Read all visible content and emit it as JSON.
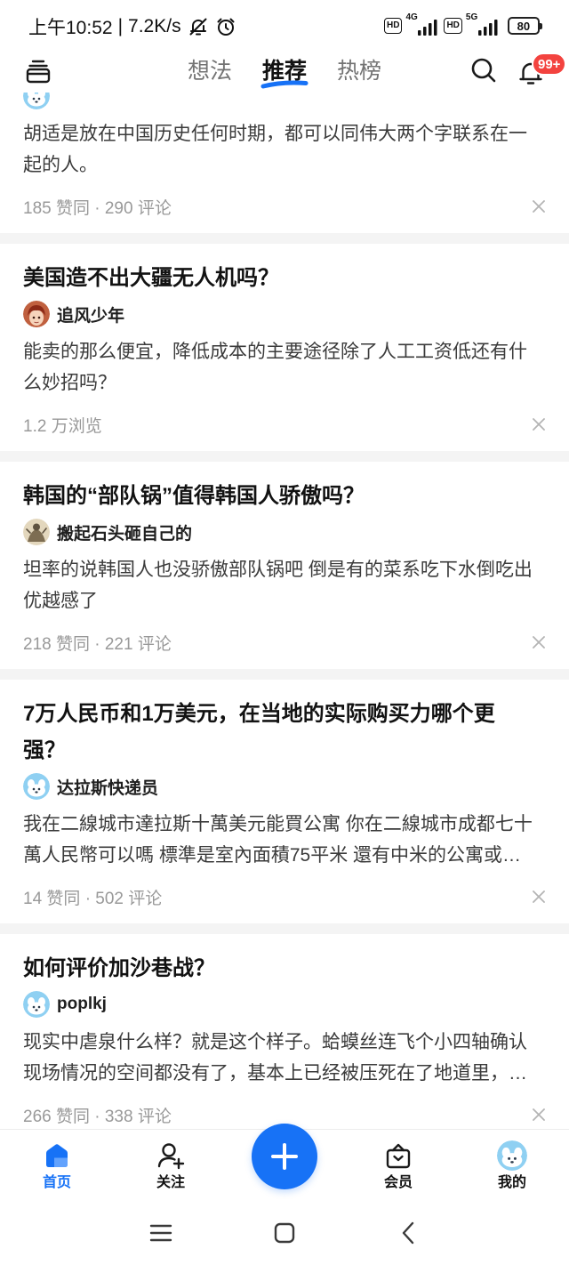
{
  "status_bar": {
    "time": "上午10:52",
    "separator": "|",
    "net_speed": "7.2K/s",
    "icons": [
      "mute-icon",
      "alarm-icon"
    ],
    "sim1": {
      "badge": "HD",
      "network": "4G"
    },
    "sim2": {
      "badge": "HD",
      "network": "5G"
    },
    "battery_level": "80"
  },
  "header": {
    "menu_icon": "menu-icon",
    "tabs": [
      {
        "label": "想法",
        "active": false
      },
      {
        "label": "推荐",
        "active": true
      },
      {
        "label": "热榜",
        "active": false
      }
    ],
    "search_icon": "search-icon",
    "notification_icon": "bell-icon",
    "notification_badge": "99+"
  },
  "feed": {
    "items": [
      {
        "avatar": "avatar-blue-dog",
        "excerpt": "胡适是放在中国历史任何时期，都可以同伟大两个字联系在一起的人。",
        "stats": "185 赞同 · 290 评论"
      },
      {
        "title": "美国造不出大疆无人机吗？",
        "author": "追风少年",
        "avatar": "avatar-anime",
        "excerpt": "能卖的那么便宜，降低成本的主要途径除了人工工资低还有什么妙招吗？",
        "stats": "1.2 万浏览"
      },
      {
        "title": "韩国的“部队锅”值得韩国人骄傲吗？",
        "author": "搬起石头砸自己的",
        "avatar": "avatar-sketch",
        "excerpt": "坦率的说韩国人也没骄傲部队锅吧 倒是有的菜系吃下水倒吃出优越感了",
        "stats": "218 赞同 · 221 评论"
      },
      {
        "title": "7万人民币和1万美元，在当地的实际购买力哪个更强？",
        "author": "达拉斯快递员",
        "avatar": "avatar-blue-dog",
        "excerpt": "我在二線城市達拉斯十萬美元能買公寓 你在二線城市成都七十萬人民幣可以嗎 標準是室內面積75平米 還有中米的公寓或…",
        "stats": "14 赞同 · 502 评论"
      },
      {
        "title": "如何评价加沙巷战？",
        "author": "poplkj",
        "avatar": "avatar-blue-dog",
        "excerpt": "现实中虐泉什么样？就是这个样子。蛤蟆丝连飞个小四轴确认现场情况的空间都没有了，基本上已经被压死在了地道里，…",
        "stats": "266 赞同 · 338 评论"
      }
    ]
  },
  "bottom_nav": {
    "items": [
      {
        "label": "首页",
        "icon": "home-icon",
        "active": true
      },
      {
        "label": "关注",
        "icon": "follow-icon",
        "active": false
      },
      {
        "label": "会员",
        "icon": "vip-bag-icon",
        "active": false
      },
      {
        "label": "我的",
        "icon": "avatar-blue-dog",
        "active": false
      }
    ],
    "compose_icon": "plus-icon"
  },
  "system_nav": {
    "icons": [
      "recent-apps-icon",
      "home-square-icon",
      "back-icon"
    ]
  },
  "colors": {
    "accent": "#1772f6",
    "badge": "#f3433f",
    "divider": "#f4f4f4",
    "text_primary": "#121212",
    "text_secondary": "#3b3b3b",
    "text_meta": "#999999",
    "tab_inactive": "#737373"
  }
}
